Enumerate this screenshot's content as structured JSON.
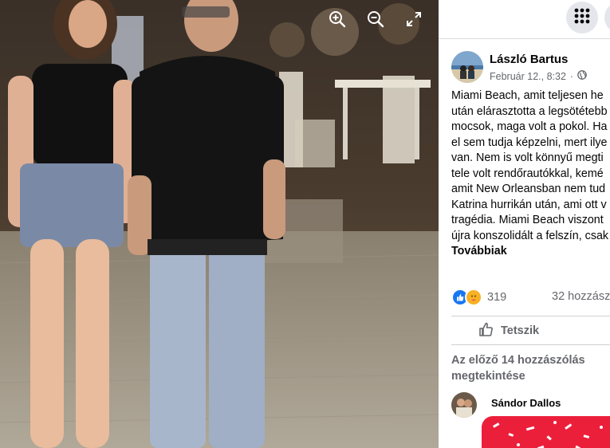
{
  "photo_controls": {
    "zoom_in": "zoom-in-icon",
    "zoom_out": "zoom-out-icon",
    "fullscreen": "fullscreen-icon"
  },
  "header": {
    "menu_icon": "grid-menu-icon"
  },
  "post": {
    "author": "László Bartus",
    "date": "Február 12., 8:32",
    "separator": "·",
    "privacy_icon": "globe-icon",
    "text_lines": [
      "Miami Beach, amit teljesen he",
      "után elárasztotta a legsötétebb",
      "mocsok, maga volt a pokol. Ha",
      "el sem tudja képzelni, mert ilye",
      "van. Nem is volt könnyű megti",
      "tele volt rendőrautókkal, kemé",
      "amit New Orleansban nem tud",
      "Katrina hurrikán után, ami ott v",
      "tragédia. Miami Beach viszont",
      "újra konszolidált a felszín, csak"
    ],
    "more_label": "Továbbiak",
    "reaction_count": "319",
    "comment_count": "32 hozzász",
    "like_label": "Tetszik"
  },
  "comments": {
    "view_previous": "Az előző 14 hozzászólás megtekintése",
    "first_author": "Sándor Dallos"
  },
  "colors": {
    "like_blue": "#1877f2",
    "haha_yellow": "#f7b125",
    "sticker_red": "#ec1f3b"
  }
}
